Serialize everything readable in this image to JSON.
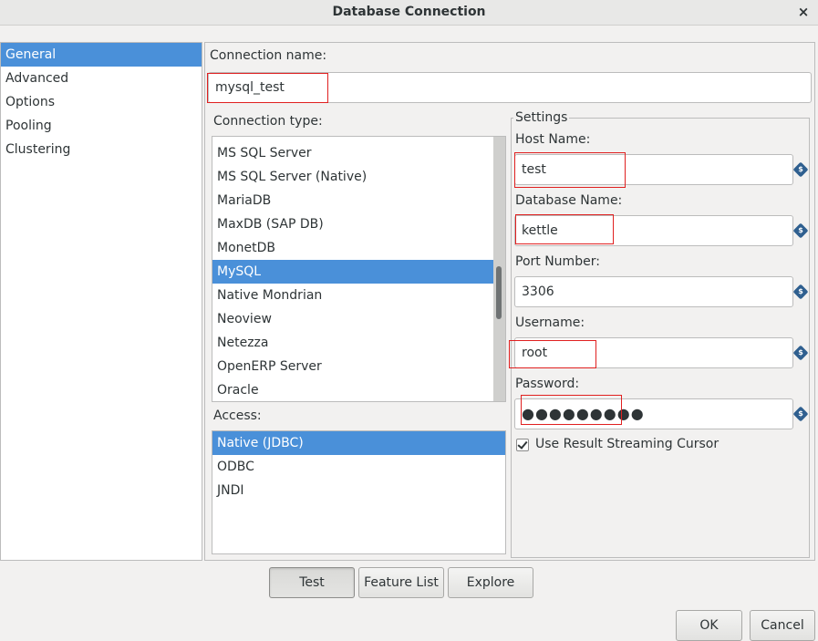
{
  "window": {
    "title": "Database Connection"
  },
  "sidebar": {
    "items": [
      {
        "label": "General"
      },
      {
        "label": "Advanced"
      },
      {
        "label": "Options"
      },
      {
        "label": "Pooling"
      },
      {
        "label": "Clustering"
      }
    ]
  },
  "connection": {
    "name_label": "Connection name:",
    "name_value": "mysql_test",
    "type_label": "Connection type:",
    "types": [
      "MS SQL Server",
      "MS SQL Server (Native)",
      "MariaDB",
      "MaxDB (SAP DB)",
      "MonetDB",
      "MySQL",
      "Native Mondrian",
      "Neoview",
      "Netezza",
      "OpenERP Server",
      "Oracle"
    ],
    "selected_type": "MySQL",
    "access_label": "Access:",
    "access_types": [
      "Native (JDBC)",
      "ODBC",
      "JNDI"
    ],
    "selected_access": "Native (JDBC)"
  },
  "settings": {
    "legend": "Settings",
    "host_label": "Host Name:",
    "host_value": "test",
    "db_label": "Database Name:",
    "db_value": "kettle",
    "port_label": "Port Number:",
    "port_value": "3306",
    "user_label": "Username:",
    "user_value": "root",
    "password_label": "Password:",
    "password_value": "●●●●●●●●●",
    "streaming_label": "Use Result Streaming Cursor",
    "streaming_checked": true
  },
  "buttons": {
    "test": "Test",
    "feature_list": "Feature List",
    "explore": "Explore",
    "ok": "OK",
    "cancel": "Cancel"
  },
  "icons": {
    "close": "×",
    "variable": "$"
  },
  "colors": {
    "selection": "#4a90d9",
    "highlight_box": "#e02020"
  }
}
